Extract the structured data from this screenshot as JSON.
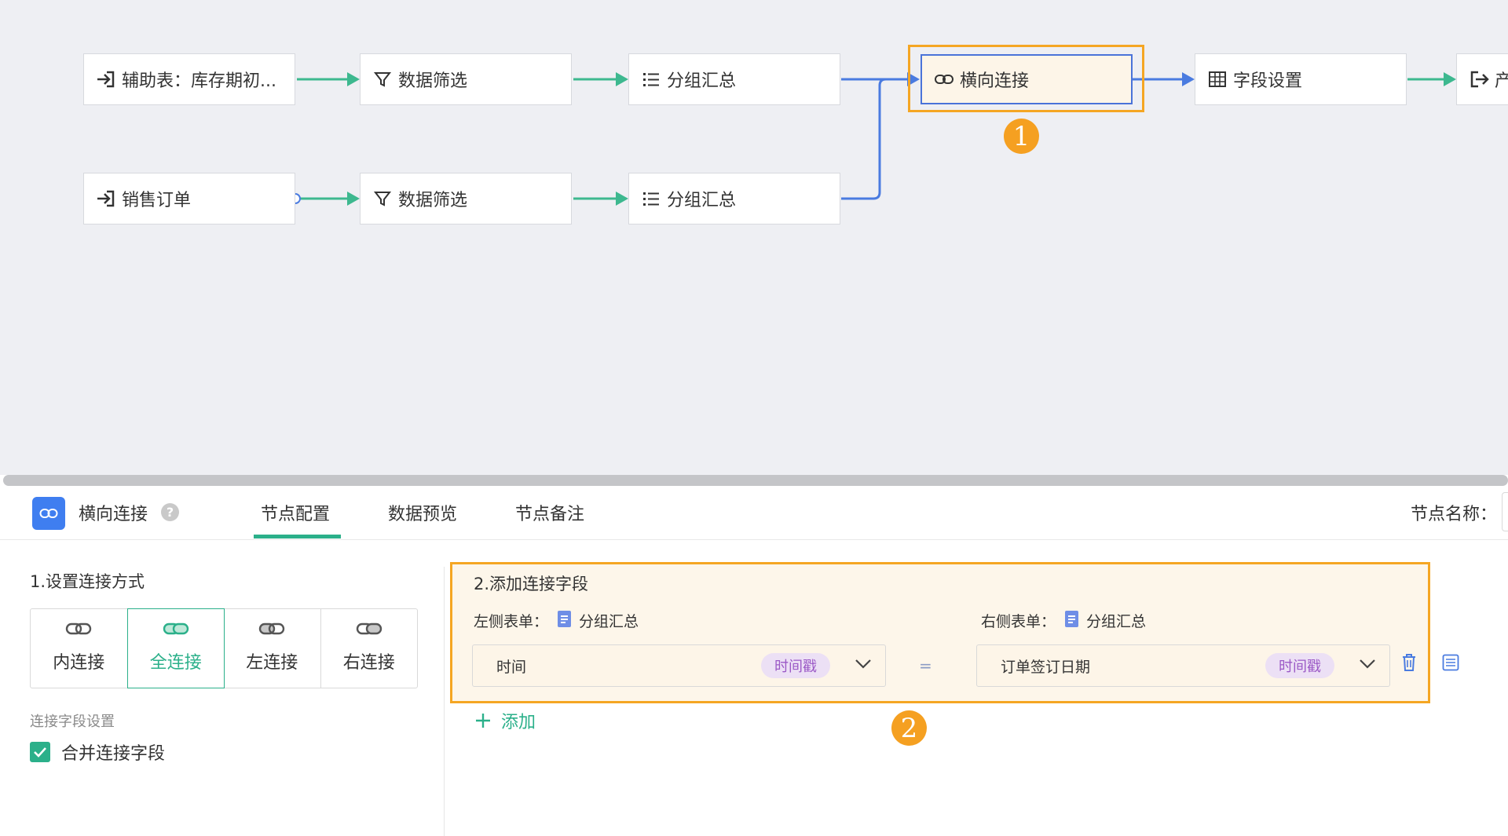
{
  "flow": {
    "nodes": [
      {
        "id": "n1",
        "label": "辅助表：库存期初...",
        "icon": "input-arrow-icon"
      },
      {
        "id": "n2",
        "label": "数据筛选",
        "icon": "filter-icon"
      },
      {
        "id": "n3",
        "label": "分组汇总",
        "icon": "list-icon"
      },
      {
        "id": "n4",
        "label": "横向连接",
        "icon": "link-icon"
      },
      {
        "id": "n5",
        "label": "字段设置",
        "icon": "table-icon"
      },
      {
        "id": "n6",
        "label": "产",
        "icon": "output-arrow-icon"
      },
      {
        "id": "n7",
        "label": "销售订单",
        "icon": "input-arrow-icon"
      },
      {
        "id": "n8",
        "label": "数据筛选",
        "icon": "filter-icon"
      },
      {
        "id": "n9",
        "label": "分组汇总",
        "icon": "list-icon"
      }
    ],
    "badges": {
      "one": "1",
      "two": "2"
    }
  },
  "panel": {
    "node_type": "横向连接",
    "help": "?",
    "tabs": [
      "节点配置",
      "数据预览",
      "节点备注"
    ],
    "active_tab": "节点配置",
    "node_name_label": "节点名称："
  },
  "join_config": {
    "title": "1.设置连接方式",
    "options": [
      "内连接",
      "全连接",
      "左连接",
      "右连接"
    ],
    "selected": "全连接",
    "field_settings_label": "连接字段设置",
    "merge_fields_label": "合并连接字段",
    "merge_fields_checked": true
  },
  "join_fields": {
    "title": "2.添加连接字段",
    "left_table_label": "左侧表单：",
    "left_table_name": "分组汇总",
    "right_table_label": "右侧表单：",
    "right_table_name": "分组汇总",
    "left_field": "时间",
    "left_field_type": "时间戳",
    "right_field": "订单签订日期",
    "right_field_type": "时间戳",
    "equals": "=",
    "add_label": "添加"
  },
  "colors": {
    "accent": "#2bb08a",
    "highlight": "#f5a623",
    "link_blue": "#4a7be0",
    "tag_purple": "#9b59c6"
  }
}
